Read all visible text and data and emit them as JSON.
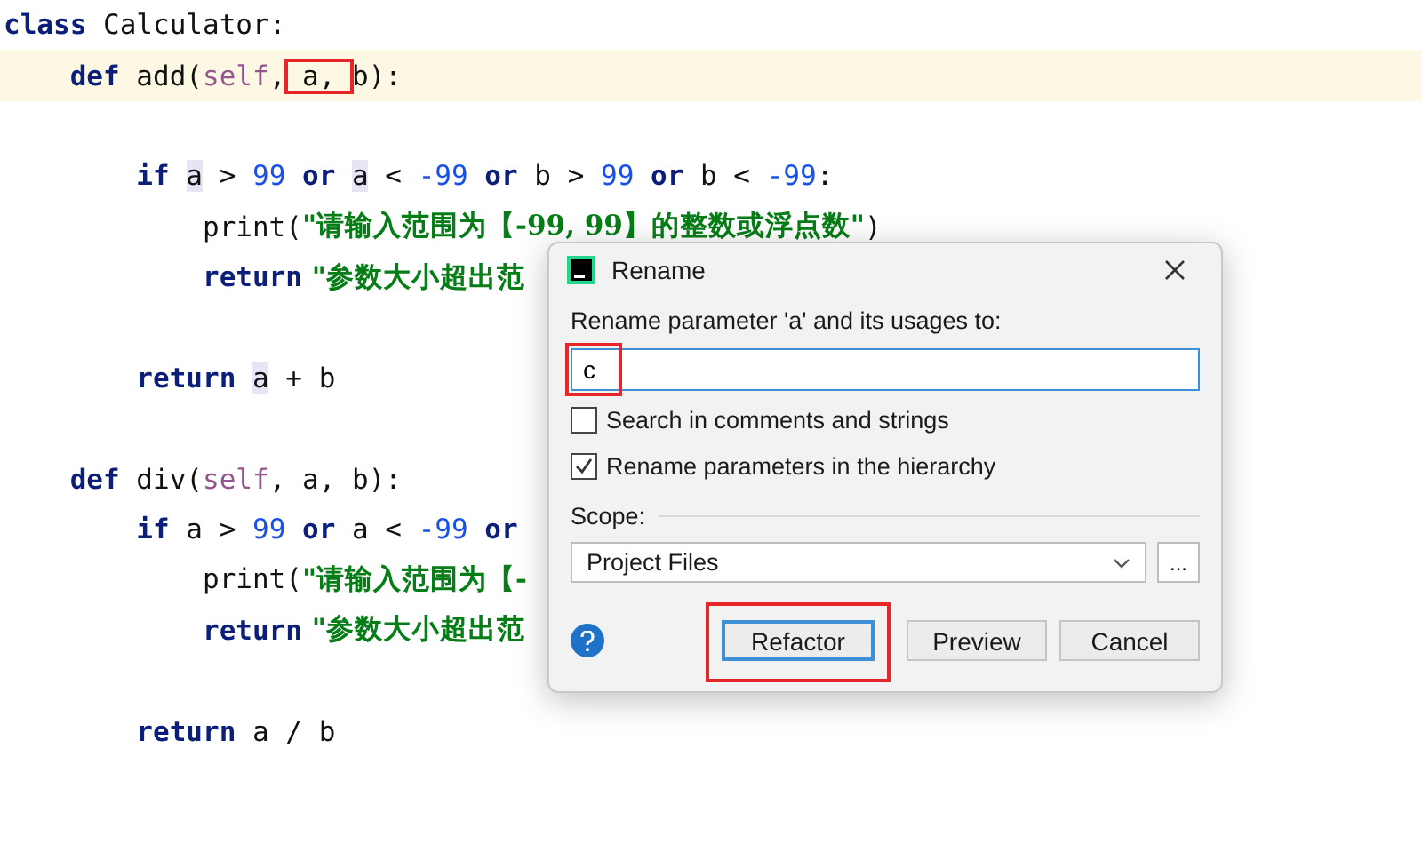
{
  "editor": {
    "lines": [
      {
        "current": false,
        "tokens": [
          {
            "kind": "kw",
            "text": "class"
          },
          {
            "kind": "plain",
            "text": " Calculator:"
          }
        ]
      },
      {
        "current": true,
        "tokens": [
          {
            "kind": "kw",
            "text": "    def "
          },
          {
            "kind": "fn",
            "text": "add"
          },
          {
            "kind": "plain",
            "text": "("
          },
          {
            "kind": "self",
            "text": "self"
          },
          {
            "kind": "plain",
            "text": ","
          },
          {
            "kind": "marked",
            "text": " a, "
          },
          {
            "kind": "plain",
            "text": "b):"
          }
        ]
      },
      {
        "current": false
      },
      {
        "current": false,
        "tokens": [
          {
            "kind": "kw",
            "text": "        if "
          },
          {
            "kind": "usage",
            "text": "a"
          },
          {
            "kind": "plain",
            "text": " > "
          },
          {
            "kind": "num",
            "text": "99"
          },
          {
            "kind": "kw",
            "text": " or "
          },
          {
            "kind": "usage",
            "text": "a"
          },
          {
            "kind": "plain",
            "text": " < "
          },
          {
            "kind": "num",
            "text": "-99"
          },
          {
            "kind": "kw",
            "text": " or "
          },
          {
            "kind": "plain",
            "text": "b > "
          },
          {
            "kind": "num",
            "text": "99"
          },
          {
            "kind": "kw",
            "text": " or "
          },
          {
            "kind": "plain",
            "text": "b < "
          },
          {
            "kind": "num",
            "text": "-99"
          },
          {
            "kind": "plain",
            "text": ":"
          }
        ]
      },
      {
        "current": false,
        "tokens": [
          {
            "kind": "plain",
            "text": "            print("
          },
          {
            "kind": "str",
            "text": "\"请输入范围为【-99, 99】的整数或浮点数\""
          },
          {
            "kind": "plain",
            "text": ")"
          }
        ]
      },
      {
        "current": false,
        "tokens": [
          {
            "kind": "kw",
            "text": "            return"
          },
          {
            "kind": "str",
            "text": " \"参数大小超出范"
          }
        ]
      },
      {
        "current": false
      },
      {
        "current": false,
        "tokens": [
          {
            "kind": "kw",
            "text": "        return "
          },
          {
            "kind": "usage",
            "text": "a"
          },
          {
            "kind": "plain",
            "text": " + b"
          }
        ]
      },
      {
        "current": false
      },
      {
        "current": false,
        "tokens": [
          {
            "kind": "kw",
            "text": "    def "
          },
          {
            "kind": "fn",
            "text": "div"
          },
          {
            "kind": "plain",
            "text": "("
          },
          {
            "kind": "self",
            "text": "self"
          },
          {
            "kind": "plain",
            "text": ", a, b):"
          }
        ]
      },
      {
        "current": false,
        "tokens": [
          {
            "kind": "kw",
            "text": "        if"
          },
          {
            "kind": "plain",
            "text": " a > "
          },
          {
            "kind": "num",
            "text": "99"
          },
          {
            "kind": "kw",
            "text": " or "
          },
          {
            "kind": "plain",
            "text": "a < "
          },
          {
            "kind": "num",
            "text": "-99"
          },
          {
            "kind": "kw",
            "text": " or"
          }
        ]
      },
      {
        "current": false,
        "tokens": [
          {
            "kind": "plain",
            "text": "            print("
          },
          {
            "kind": "str",
            "text": "\"请输入范围为【-"
          }
        ]
      },
      {
        "current": false,
        "tokens": [
          {
            "kind": "kw",
            "text": "            return"
          },
          {
            "kind": "str",
            "text": " \"参数大小超出范"
          }
        ]
      },
      {
        "current": false
      },
      {
        "current": false,
        "tokens": [
          {
            "kind": "kw",
            "text": "        return"
          },
          {
            "kind": "plain",
            "text": " a / b"
          }
        ]
      }
    ]
  },
  "dialog": {
    "title": "Rename",
    "label": "Rename parameter 'a' and its usages to:",
    "field": {
      "value": "c",
      "annotated": true
    },
    "options": [
      {
        "label": "Search in comments and strings",
        "checked": false
      },
      {
        "label": "Rename parameters in the hierarchy",
        "checked": true
      }
    ],
    "scope_label": "Scope:",
    "scope": {
      "value": "Project Files"
    },
    "browse": "...",
    "buttons": [
      {
        "label": "Refactor",
        "default": true,
        "annotated": true
      },
      {
        "label": "Preview",
        "default": false,
        "annotated": false
      },
      {
        "label": "Cancel",
        "default": false,
        "annotated": false
      }
    ]
  }
}
